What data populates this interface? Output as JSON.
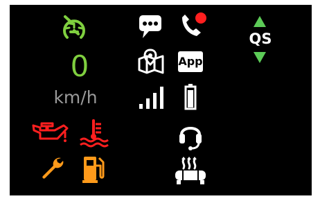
{
  "cluster": {
    "speed": {
      "value": "0",
      "unit": "km/h"
    },
    "quickshifter": {
      "label": "QS"
    },
    "apps": {
      "label": "App"
    },
    "colors": {
      "background": "#000000",
      "speed_green": "#7fcf3f",
      "unit_gray": "#9a9a9a",
      "warning_red": "#ff1f1f",
      "service_orange": "#ff9a1a",
      "fuel_orange": "#ff9a1a",
      "icon_white": "#ffffff",
      "qs_green": "#5ccb57"
    },
    "icons": [
      "cruise-control-icon",
      "message-icon",
      "phone-call-icon",
      "navigation-map-icon",
      "app-icon",
      "signal-strength-icon",
      "battery-icon",
      "oil-pressure-warning-icon",
      "coolant-temperature-warning-icon",
      "headset-icon",
      "service-wrench-icon",
      "fuel-icon",
      "heated-grips-icon",
      "quickshifter-up-arrow-icon",
      "quickshifter-down-arrow-icon"
    ]
  }
}
